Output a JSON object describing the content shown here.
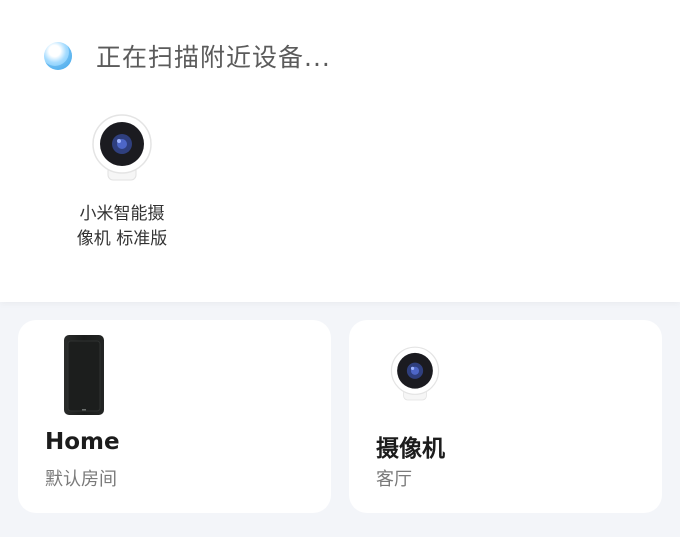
{
  "scan": {
    "status_text": "正在扫描附近设备..."
  },
  "found_devices": [
    {
      "name": "小米智能摄\n像机 标准版",
      "icon": "camera-icon"
    }
  ],
  "devices": [
    {
      "name": "Home",
      "room": "默认房间",
      "icon": "router-icon"
    },
    {
      "name": "摄像机",
      "room": "客厅",
      "icon": "camera-icon"
    }
  ],
  "colors": {
    "background": "#f3f5f9",
    "card": "#ffffff",
    "scan_indicator": "#4fb6f3",
    "title_text": "#1c1c1c",
    "secondary_text": "#7a7a7a"
  }
}
